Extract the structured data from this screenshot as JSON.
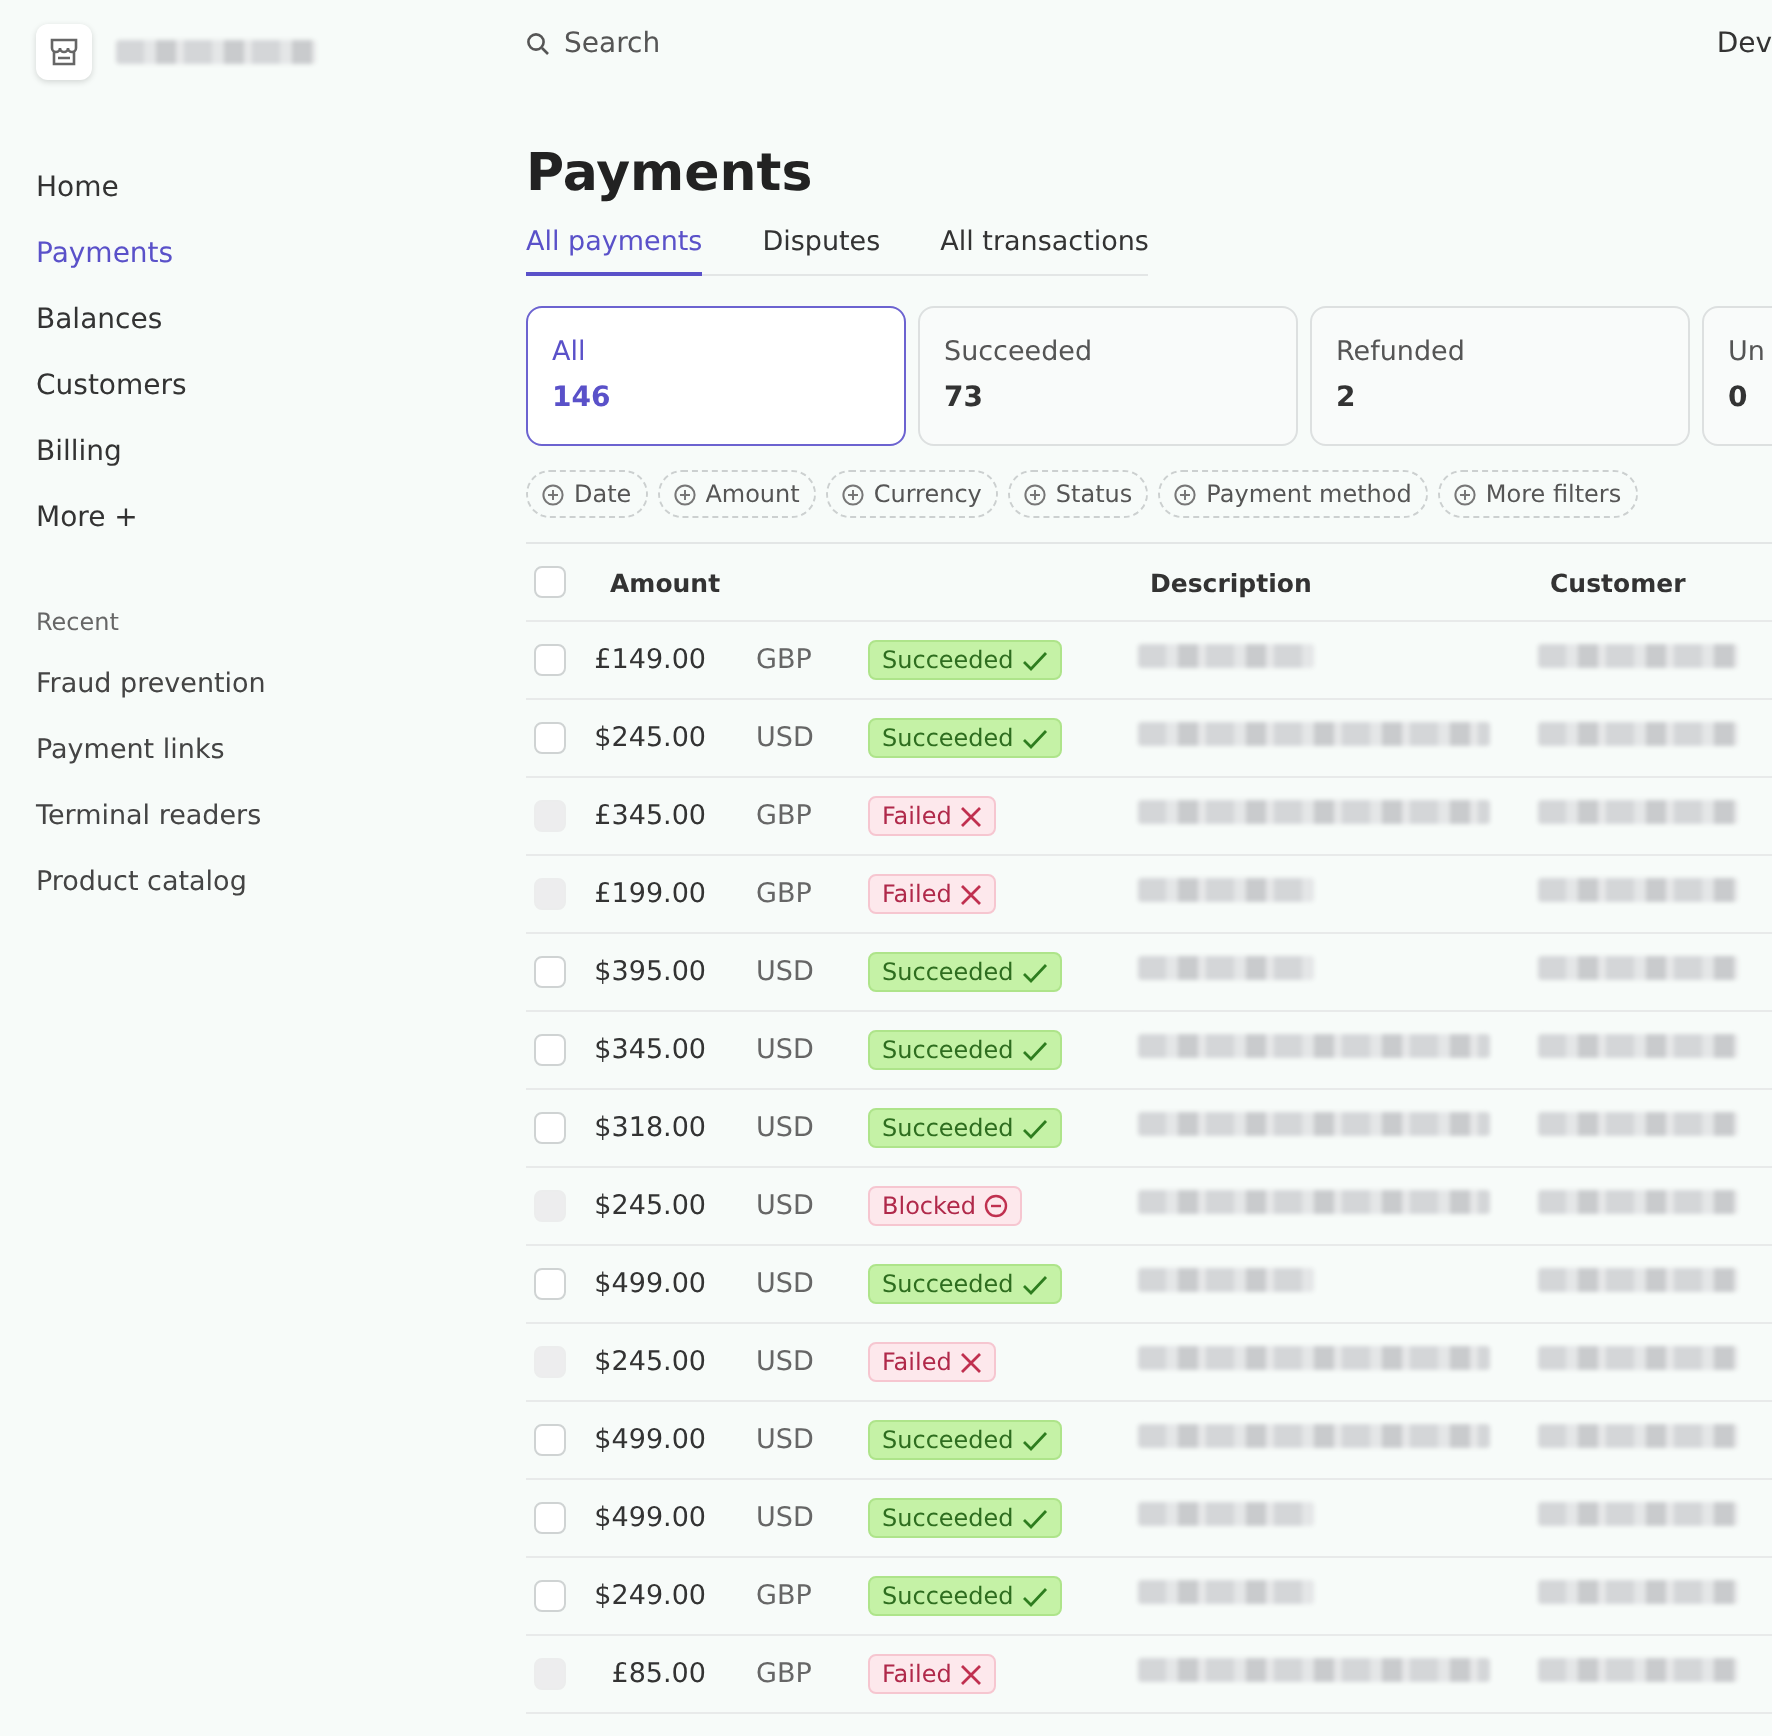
{
  "sidebar": {
    "items": [
      {
        "label": "Home",
        "selected": false
      },
      {
        "label": "Payments",
        "selected": true
      },
      {
        "label": "Balances",
        "selected": false
      },
      {
        "label": "Customers",
        "selected": false
      },
      {
        "label": "Billing",
        "selected": false
      },
      {
        "label": "More +",
        "selected": false
      }
    ],
    "recent_heading": "Recent",
    "recent": [
      "Fraud prevention",
      "Payment links",
      "Terminal readers",
      "Product catalog"
    ]
  },
  "topbar": {
    "search_placeholder": "Search",
    "right_link": "Dev"
  },
  "title": "Payments",
  "tabs": [
    {
      "label": "All payments",
      "selected": true
    },
    {
      "label": "Disputes",
      "selected": false
    },
    {
      "label": "All transactions",
      "selected": false
    }
  ],
  "summary_cards": [
    {
      "label": "All",
      "count": "146",
      "selected": true
    },
    {
      "label": "Succeeded",
      "count": "73",
      "selected": false
    },
    {
      "label": "Refunded",
      "count": "2",
      "selected": false
    },
    {
      "label": "Un",
      "count": "0",
      "selected": false
    }
  ],
  "filters": [
    "Date",
    "Amount",
    "Currency",
    "Status",
    "Payment method",
    "More filters"
  ],
  "table": {
    "select_all": {
      "checked": false
    },
    "columns": [
      "Amount",
      "Description",
      "Customer"
    ],
    "rows": [
      {
        "amount": "£149.00",
        "currency": "GBP",
        "status": "Succeeded",
        "kind": "succeeded",
        "disabled": false
      },
      {
        "amount": "$245.00",
        "currency": "USD",
        "status": "Succeeded",
        "kind": "succeeded",
        "disabled": false
      },
      {
        "amount": "£345.00",
        "currency": "GBP",
        "status": "Failed",
        "kind": "failed",
        "disabled": true
      },
      {
        "amount": "£199.00",
        "currency": "GBP",
        "status": "Failed",
        "kind": "failed",
        "disabled": true
      },
      {
        "amount": "$395.00",
        "currency": "USD",
        "status": "Succeeded",
        "kind": "succeeded",
        "disabled": false
      },
      {
        "amount": "$345.00",
        "currency": "USD",
        "status": "Succeeded",
        "kind": "succeeded",
        "disabled": false
      },
      {
        "amount": "$318.00",
        "currency": "USD",
        "status": "Succeeded",
        "kind": "succeeded",
        "disabled": false
      },
      {
        "amount": "$245.00",
        "currency": "USD",
        "status": "Blocked",
        "kind": "blocked",
        "disabled": true
      },
      {
        "amount": "$499.00",
        "currency": "USD",
        "status": "Succeeded",
        "kind": "succeeded",
        "disabled": false
      },
      {
        "amount": "$245.00",
        "currency": "USD",
        "status": "Failed",
        "kind": "failed",
        "disabled": true
      },
      {
        "amount": "$499.00",
        "currency": "USD",
        "status": "Succeeded",
        "kind": "succeeded",
        "disabled": false
      },
      {
        "amount": "$499.00",
        "currency": "USD",
        "status": "Succeeded",
        "kind": "succeeded",
        "disabled": false
      },
      {
        "amount": "$249.00",
        "currency": "GBP",
        "status": "Succeeded",
        "kind": "succeeded",
        "disabled": false
      },
      {
        "amount": "£85.00",
        "currency": "GBP",
        "status": "Failed",
        "kind": "failed",
        "disabled": true
      }
    ]
  }
}
